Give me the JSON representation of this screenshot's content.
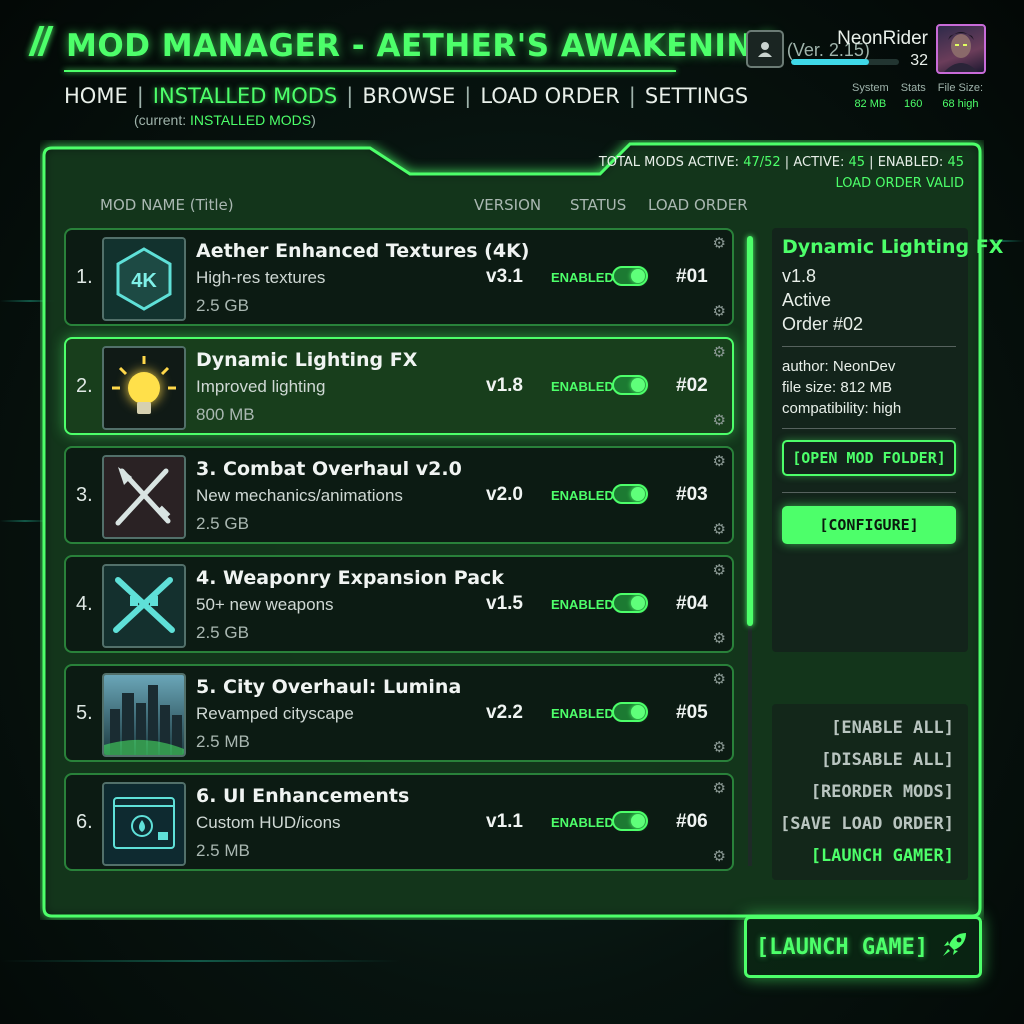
{
  "app": {
    "title": "MOD MANAGER - AETHER'S AWAKENING",
    "version": "(Ver. 2.15)"
  },
  "nav": {
    "items": [
      {
        "label": "HOME"
      },
      {
        "label": "INSTALLED MODS",
        "active": true
      },
      {
        "label": "BROWSE"
      },
      {
        "label": "LOAD ORDER"
      },
      {
        "label": "SETTINGS"
      }
    ],
    "separator": "|",
    "current_prefix": "(current: ",
    "current_value": "INSTALLED MODS",
    "current_suffix": ")"
  },
  "user": {
    "name": "NeonRider",
    "level": "32",
    "xp_fraction": 0.72,
    "icons": {
      "user": "user-icon",
      "avatar": "avatar-portrait"
    },
    "stats": [
      {
        "label": "System",
        "value": "82 MB"
      },
      {
        "label": "Stats",
        "value": "160"
      },
      {
        "label": "File Size:",
        "value": "68 high"
      }
    ]
  },
  "summary": {
    "total_label": "TOTAL MODS ACTIVE:",
    "total_value": "47/52",
    "active_label": "ACTIVE:",
    "active_value": "45",
    "enabled_label": "ENABLED:",
    "enabled_value": "45",
    "sep": "|",
    "status": "LOAD ORDER VALID"
  },
  "columns": {
    "name": "MOD NAME (Title)",
    "version": "VERSION",
    "status": "STATUS",
    "order": "LOAD ORDER"
  },
  "mods": [
    {
      "num": "1.",
      "name": "Aether Enhanced Textures (4K)",
      "desc": "High-res textures",
      "size": "2.5 GB",
      "version": "v3.1",
      "status": "ENABLED",
      "order": "#01",
      "icon": "4k-texture-icon",
      "badge": "4K"
    },
    {
      "num": "2.",
      "name": "Dynamic Lighting FX",
      "desc": "Improved lighting",
      "size": "800 MB",
      "version": "v1.8",
      "status": "ENABLED",
      "order": "#02",
      "icon": "lightbulb-icon",
      "selected": true
    },
    {
      "num": "3.",
      "name": "3. Combat Overhaul v2.0",
      "desc": "New mechanics/animations",
      "size": "2.5 GB",
      "version": "v2.0",
      "status": "ENABLED",
      "order": "#03",
      "icon": "crossed-weapons-icon"
    },
    {
      "num": "4.",
      "name": "4. Weaponry Expansion Pack",
      "desc": "50+ new weapons",
      "size": "2.5 GB",
      "version": "v1.5",
      "status": "ENABLED",
      "order": "#04",
      "icon": "crossed-rifles-icon"
    },
    {
      "num": "5.",
      "name": "5. City Overhaul: Lumina",
      "desc": "Revamped cityscape",
      "size": "2.5 MB",
      "version": "v2.2",
      "status": "ENABLED",
      "order": "#05",
      "icon": "city-skyline-icon"
    },
    {
      "num": "6.",
      "name": "6. UI Enhancements",
      "desc": "Custom HUD/icons",
      "size": "2.5 MB",
      "version": "v1.1",
      "status": "ENABLED",
      "order": "#06",
      "icon": "hud-window-icon"
    }
  ],
  "detail": {
    "title": "Dynamic Lighting FX",
    "version": "v1.8",
    "state": "Active",
    "order": "Order #02",
    "author": "author: NeonDev",
    "file_size": "file size: 812 MB",
    "compatibility": "compatibility: high",
    "open_folder": "[OPEN MOD FOLDER]",
    "configure": "[CONFIGURE]"
  },
  "actions": [
    {
      "label": "[ENABLE ALL]"
    },
    {
      "label": "[DISABLE ALL]"
    },
    {
      "label": "[REORDER MODS]"
    },
    {
      "label": "[SAVE LOAD ORDER]"
    },
    {
      "label": "[LAUNCH GAMER]",
      "highlight": true
    }
  ],
  "launch": {
    "label": "[LAUNCH GAME]",
    "icon": "rocket-icon"
  },
  "colors": {
    "accent": "#4dff6a",
    "xp": "#3fd8e8",
    "avatar_border": "#c86bd8",
    "background": "#07130f"
  }
}
